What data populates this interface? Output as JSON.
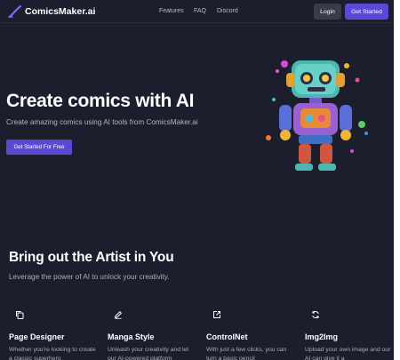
{
  "nav": {
    "brand": "ComicsMaker.ai",
    "links": [
      "Features",
      "FAQ",
      "Discord"
    ],
    "login_label": "Login",
    "get_started_label": "Get Started"
  },
  "hero": {
    "title": "Create comics with AI",
    "subtitle": "Create amazing comics using AI tools from ComicsMaker.ai",
    "cta_label": "Get Started For Free"
  },
  "section": {
    "title": "Bring out the Artist in You",
    "subtitle": "Leverage the power of AI to unlock your creativity."
  },
  "features": [
    {
      "icon": "copy-icon",
      "title": "Page Designer",
      "desc": "Whether you're looking to create a classic superhero"
    },
    {
      "icon": "edit-icon",
      "title": "Manga Style",
      "desc": "Unleash your creativity and let our AI-powered platform"
    },
    {
      "icon": "external-edit-icon",
      "title": "ControlNet",
      "desc": "With just a few clicks, you can turn a basic pencil"
    },
    {
      "icon": "refresh-icon",
      "title": "Img2Img",
      "desc": "Upload your own image and our AI can give it a"
    }
  ],
  "colors": {
    "background": "#1c1e2e",
    "accent": "#5b49d6",
    "login_bg": "#3a3c4c"
  }
}
